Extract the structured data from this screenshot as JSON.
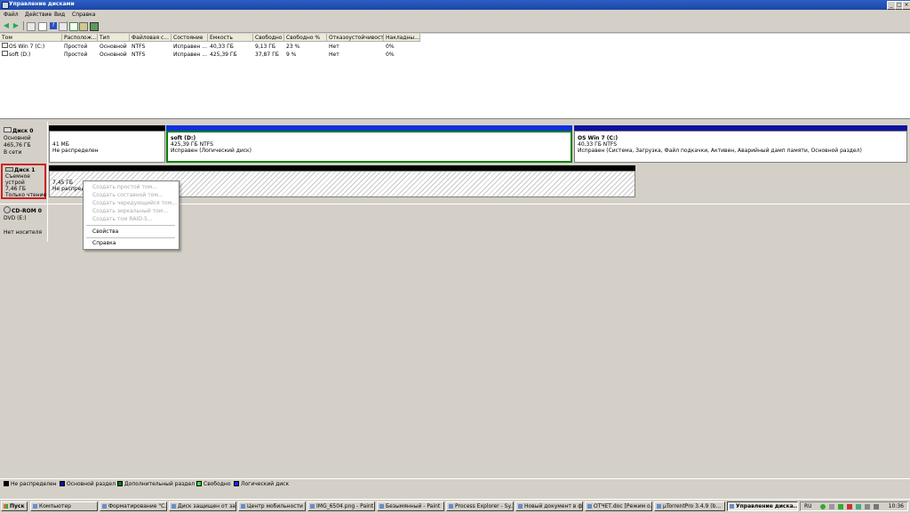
{
  "window": {
    "title": "Управление дисками",
    "min": "_",
    "max": "□",
    "close": "×"
  },
  "menu": [
    "Файл",
    "Действие",
    "Вид",
    "Справка"
  ],
  "volume_table": {
    "columns": [
      "Том",
      "Располож...",
      "Тип",
      "Файловая с...",
      "Состояние",
      "Емкость",
      "Свободно",
      "Свободно %",
      "Отказоустойчивость",
      "Накладны..."
    ],
    "rows": [
      [
        "OS Win 7 (C:)",
        "Простой",
        "Основной",
        "NTFS",
        "Исправен ...",
        "40,33 ГБ",
        "9,13 ГБ",
        "23 %",
        "Нет",
        "0%"
      ],
      [
        "soft (D:)",
        "Простой",
        "Основной",
        "NTFS",
        "Исправен ...",
        "425,39 ГБ",
        "37,87 ГБ",
        "9 %",
        "Нет",
        "0%"
      ]
    ]
  },
  "disks": {
    "disk0": {
      "name": "Диск 0",
      "type": "Основной",
      "size": "465,76 ГБ",
      "status": "В сети",
      "p1": {
        "size": "41 МБ",
        "status": "Не распределен"
      },
      "p2": {
        "name": "soft (D:)",
        "size": "425,39 ГБ NTFS",
        "status": "Исправен (Логический диск)"
      },
      "p3": {
        "name": "OS Win 7 (C:)",
        "size": "40,33 ГБ NTFS",
        "status": "Исправен (Система, Загрузка, Файл подкачки, Активен, Аварийный дамп памяти, Основной раздел)"
      }
    },
    "disk1": {
      "name": "Диск 1",
      "type": "Съемное устрой",
      "size": "7,46 ГБ",
      "status": "Только чтение",
      "p1": {
        "size": "7,45 ГБ",
        "status": "Не распредел"
      }
    },
    "cdrom0": {
      "name": "CD-ROM 0",
      "type": "DVD (E:)",
      "status": "Нет носителя"
    }
  },
  "context_menu": {
    "disabled": [
      "Создать простой том...",
      "Создать составной том...",
      "Создать чередующийся том...",
      "Создать зеркальный том...",
      "Создать том RAID-5..."
    ],
    "properties": "Свойства",
    "help": "Справка"
  },
  "legend": [
    {
      "label": "Не распределен",
      "color": "#000000"
    },
    {
      "label": "Основной раздел",
      "color": "#1010a0"
    },
    {
      "label": "Дополнительный раздел",
      "color": "#008000"
    },
    {
      "label": "Свободно",
      "color": "#40e040"
    },
    {
      "label": "Логический диск",
      "color": "#1030e0"
    }
  ],
  "colors": {
    "primary": "#1010a0",
    "logical": "#1030e0",
    "unallocated": "#000000",
    "selected_outline": "#008000",
    "disk_highlight": "#d02020"
  },
  "taskbar": {
    "start": "Пуск",
    "tasks": [
      "Компьютер",
      "Форматирование \"C...",
      "Диск защищен от за...",
      "Центр мобильности ...",
      "IMG_6504.png - Paint",
      "Безымянный - Paint",
      "Process Explorer - Sy...",
      "Новый документ в ф...",
      "ОТЧЕТ.doc [Режим о...",
      "µTorrentPro 3.4.9 (b...",
      "Управление диска..."
    ],
    "lang": "RU",
    "time": "10:36"
  }
}
